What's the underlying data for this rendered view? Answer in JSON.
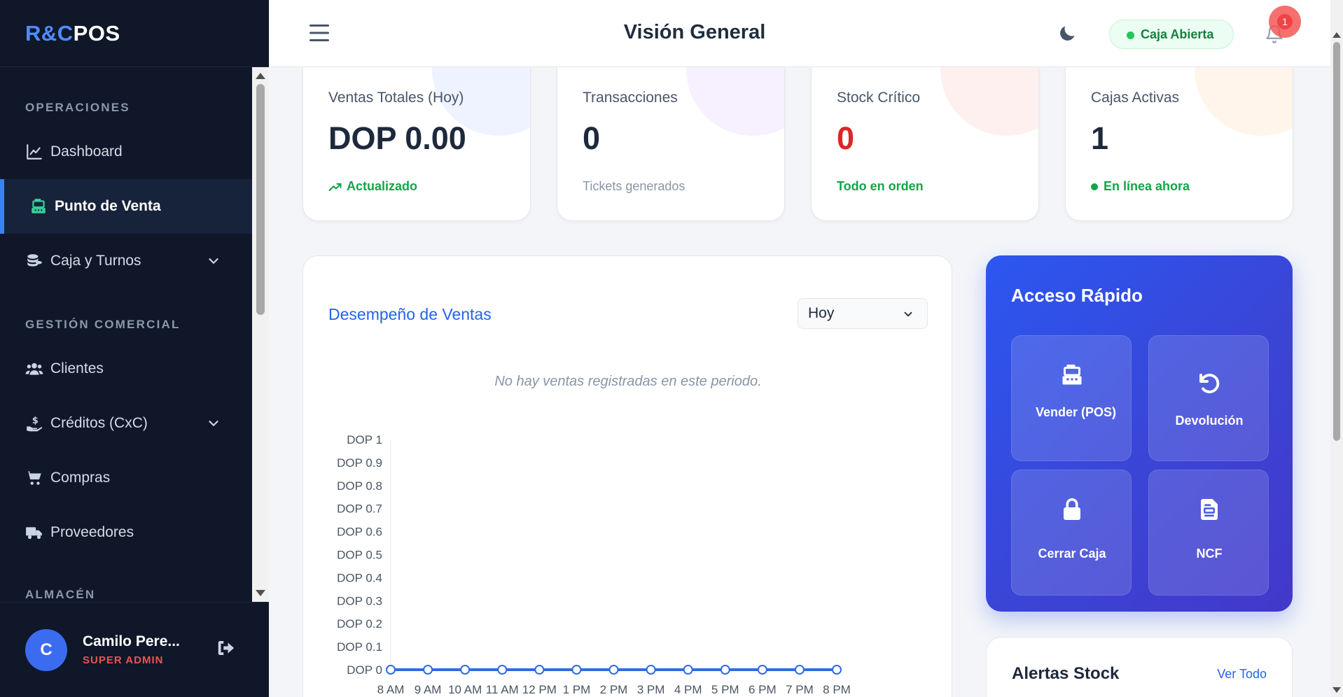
{
  "brand": {
    "part1": "R&C",
    "part2": "POS"
  },
  "sidebar": {
    "sections": {
      "operaciones": "OPERACIONES",
      "gestion": "GESTIÓN COMERCIAL",
      "almacen": "ALMACÉN"
    },
    "items": {
      "dashboard": "Dashboard",
      "pos": "Punto de Venta",
      "caja": "Caja y Turnos",
      "clientes": "Clientes",
      "creditos": "Créditos (CxC)",
      "compras": "Compras",
      "proveedores": "Proveedores"
    },
    "user": {
      "initial": "C",
      "name": "Camilo Pere...",
      "role": "SUPER ADMIN"
    }
  },
  "header": {
    "title": "Visión General",
    "status": "Caja Abierta",
    "notifications": "1"
  },
  "stats": [
    {
      "label": "Ventas Totales (Hoy)",
      "value": "DOP 0.00",
      "sub": "Actualizado"
    },
    {
      "label": "Transacciones",
      "value": "0",
      "sub": "Tickets generados"
    },
    {
      "label": "Stock Crítico",
      "value": "0",
      "sub": "Todo en orden"
    },
    {
      "label": "Cajas Activas",
      "value": "1",
      "sub": "En línea ahora"
    }
  ],
  "colors": {
    "accent": "#2563eb",
    "success": "#16a34a",
    "danger": "#dc2626",
    "sidebar": "#0f1729"
  },
  "sales": {
    "title": "Desempeño de Ventas",
    "period": "Hoy",
    "empty": "No hay ventas registradas en este periodo."
  },
  "chart_data": {
    "type": "line",
    "categories": [
      "8 AM",
      "9 AM",
      "10 AM",
      "11 AM",
      "12 PM",
      "1 PM",
      "2 PM",
      "3 PM",
      "4 PM",
      "5 PM",
      "6 PM",
      "7 PM",
      "8 PM"
    ],
    "series": [
      {
        "values": [
          0,
          0,
          0,
          0,
          0,
          0,
          0,
          0,
          0,
          0,
          0,
          0,
          0
        ]
      }
    ],
    "ylim": [
      0,
      1
    ],
    "yticks": [
      "DOP 0",
      "DOP 0.1",
      "DOP 0.2",
      "DOP 0.3",
      "DOP 0.4",
      "DOP 0.5",
      "DOP 0.6",
      "DOP 0.7",
      "DOP 0.8",
      "DOP 0.9",
      "DOP 1"
    ],
    "title": "",
    "xlabel": "",
    "ylabel": "",
    "grid": false,
    "line_color": "#2f6be4"
  },
  "quick": {
    "title": "Acceso Rápido",
    "vender": "Vender (POS)",
    "devolucion": "Devolución",
    "cerrar": "Cerrar Caja",
    "ncf": "NCF"
  },
  "alerts": {
    "title": "Alertas Stock",
    "link": "Ver Todo"
  }
}
